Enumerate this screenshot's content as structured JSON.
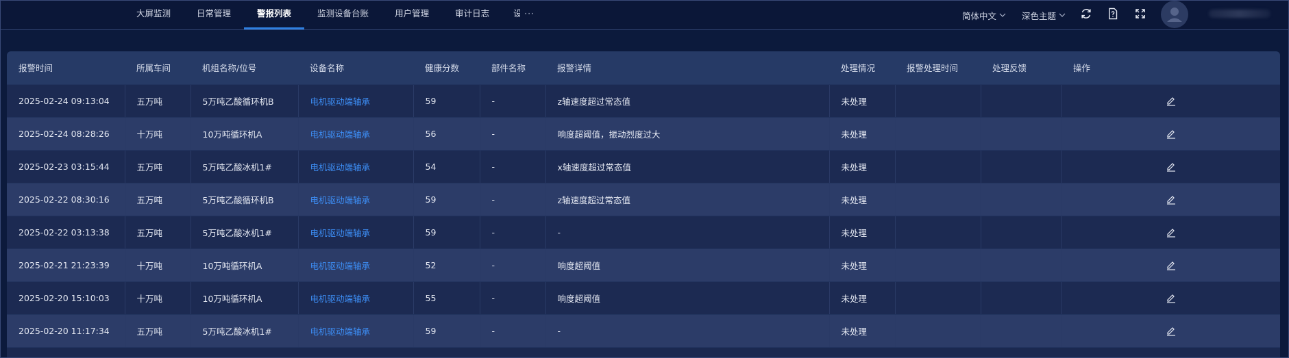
{
  "nav": {
    "items": [
      {
        "label": "大屏监测",
        "active": false
      },
      {
        "label": "日常管理",
        "active": false
      },
      {
        "label": "警报列表",
        "active": true
      },
      {
        "label": "监测设备台账",
        "active": false
      },
      {
        "label": "用户管理",
        "active": false
      },
      {
        "label": "审计日志",
        "active": false
      }
    ],
    "clipped_label": "设",
    "more_label": "···"
  },
  "toolbar": {
    "language": "简体中文",
    "theme": "深色主题",
    "icons": [
      "refresh-icon",
      "document-help-icon",
      "fullscreen-icon"
    ],
    "avatar_icon": "user-avatar-icon"
  },
  "table": {
    "headers": [
      "报警时间",
      "所属车间",
      "机组名称/位号",
      "设备名称",
      "健康分数",
      "部件名称",
      "报警详情",
      "处理情况",
      "报警处理时间",
      "处理反馈",
      "操作"
    ],
    "rows": [
      {
        "time": "2025-02-24 09:13:04",
        "workshop": "五万吨",
        "unit": "5万吨乙酸循环机B",
        "device": "电机驱动端轴承",
        "score": "59",
        "part": "-",
        "detail": "z轴速度超过常态值",
        "status": "未处理",
        "handled_time": "",
        "feedback": ""
      },
      {
        "time": "2025-02-24 08:28:26",
        "workshop": "十万吨",
        "unit": "10万吨循环机A",
        "device": "电机驱动端轴承",
        "score": "56",
        "part": "-",
        "detail": "响度超阈值，振动烈度过大",
        "status": "未处理",
        "handled_time": "",
        "feedback": ""
      },
      {
        "time": "2025-02-23 03:15:44",
        "workshop": "五万吨",
        "unit": "5万吨乙酸冰机1#",
        "device": "电机驱动端轴承",
        "score": "54",
        "part": "-",
        "detail": "x轴速度超过常态值",
        "status": "未处理",
        "handled_time": "",
        "feedback": ""
      },
      {
        "time": "2025-02-22 08:30:16",
        "workshop": "五万吨",
        "unit": "5万吨乙酸循环机B",
        "device": "电机驱动端轴承",
        "score": "59",
        "part": "-",
        "detail": "z轴速度超过常态值",
        "status": "未处理",
        "handled_time": "",
        "feedback": ""
      },
      {
        "time": "2025-02-22 03:13:38",
        "workshop": "五万吨",
        "unit": "5万吨乙酸冰机1#",
        "device": "电机驱动端轴承",
        "score": "59",
        "part": "-",
        "detail": "-",
        "status": "未处理",
        "handled_time": "",
        "feedback": ""
      },
      {
        "time": "2025-02-21 21:23:39",
        "workshop": "十万吨",
        "unit": "10万吨循环机A",
        "device": "电机驱动端轴承",
        "score": "52",
        "part": "-",
        "detail": "响度超阈值",
        "status": "未处理",
        "handled_time": "",
        "feedback": ""
      },
      {
        "time": "2025-02-20 15:10:03",
        "workshop": "十万吨",
        "unit": "10万吨循环机A",
        "device": "电机驱动端轴承",
        "score": "55",
        "part": "-",
        "detail": "响度超阈值",
        "status": "未处理",
        "handled_time": "",
        "feedback": ""
      },
      {
        "time": "2025-02-20 11:17:34",
        "workshop": "五万吨",
        "unit": "5万吨乙酸冰机1#",
        "device": "电机驱动端轴承",
        "score": "59",
        "part": "-",
        "detail": "-",
        "status": "未处理",
        "handled_time": "",
        "feedback": ""
      }
    ],
    "action_icon": "edit-icon"
  },
  "colors": {
    "background": "#0c1a3c",
    "topbar": "#0b1738",
    "header_row": "#263a66",
    "row_odd": "#1c2a52",
    "row_even": "#2c3c68",
    "link": "#3d8ef5",
    "active_underline": "#2f7fe0"
  }
}
